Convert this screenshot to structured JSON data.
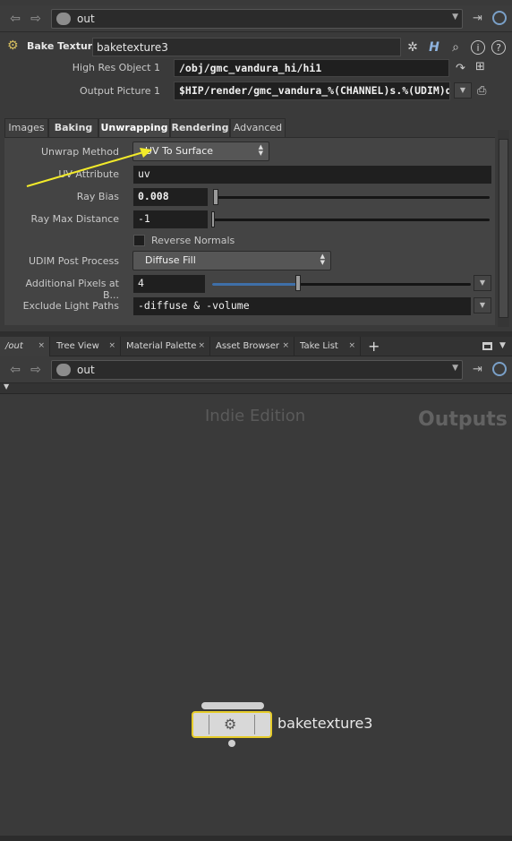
{
  "top_path": {
    "value": "out",
    "back_icon": "back-arrow-icon",
    "forward_icon": "forward-arrow-icon"
  },
  "operator": {
    "type_label": "Bake Texture",
    "name": "baketexture3",
    "toolbar_icons": [
      "gear-icon",
      "houdini-help-icon",
      "search-icon",
      "info-icon",
      "help-icon"
    ]
  },
  "params_top": {
    "high_res_label": "High Res Object 1",
    "high_res_value": "/obj/gmc_vandura_hi/hi1",
    "output_label": "Output Picture 1",
    "output_value": "$HIP/render/gmc_vandura_%(CHANNEL)s.%(UDIM)d.exr"
  },
  "tabs": [
    "Images",
    "Baking",
    "Unwrapping",
    "Rendering",
    "Advanced"
  ],
  "active_tab": "Unwrapping",
  "unwrapping": {
    "unwrap_method_label": "Unwrap Method",
    "unwrap_method_value": "UV To Surface",
    "uv_attribute_label": "UV Attribute",
    "uv_attribute_value": "uv",
    "ray_bias_label": "Ray Bias",
    "ray_bias_value": "0.008",
    "ray_max_label": "Ray Max Distance",
    "ray_max_value": "-1",
    "reverse_normals_label": "Reverse Normals",
    "reverse_normals_checked": false,
    "udim_label": "UDIM Post Process",
    "udim_value": "Diffuse Fill",
    "add_pixels_label": "Additional Pixels at B...",
    "add_pixels_value": "4",
    "exclude_label": "Exclude Light Paths",
    "exclude_value": "-diffuse & -volume"
  },
  "pane_tabs": [
    {
      "label": "/out",
      "active": true
    },
    {
      "label": "Tree View",
      "active": false
    },
    {
      "label": "Material Palette",
      "active": false
    },
    {
      "label": "Asset Browser",
      "active": false
    },
    {
      "label": "Take List",
      "active": false
    }
  ],
  "add_tab_label": "+",
  "network_path": {
    "value": "out"
  },
  "network": {
    "watermark": "Indie Edition",
    "context_label": "Outputs",
    "node_name": "baketexture3"
  },
  "colors": {
    "annotation_arrow": "#f2ea2a",
    "node_selected": "#e6cc2a",
    "slider_fill": "#3f6fa8"
  }
}
